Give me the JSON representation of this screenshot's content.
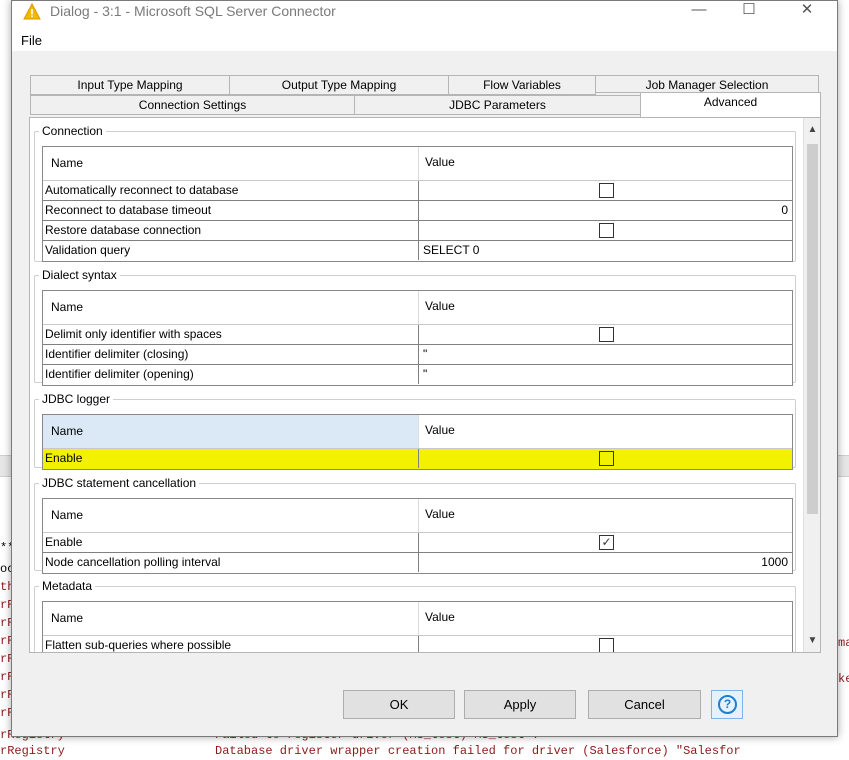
{
  "window": {
    "title": "Dialog - 3:1 - Microsoft SQL Server Connector",
    "controls": {
      "minimize": "—",
      "maximize": "☐",
      "close": "✕"
    }
  },
  "menu": {
    "file": "File"
  },
  "tabs": {
    "row1": [
      "Input Type Mapping",
      "Output Type Mapping",
      "Flow Variables",
      "Job Manager Selection"
    ],
    "row2": [
      "Connection Settings",
      "JDBC Parameters",
      "Advanced"
    ],
    "active": "Advanced"
  },
  "table_headers": {
    "name": "Name",
    "value": "Value"
  },
  "sections": {
    "connection": {
      "title": "Connection",
      "rows": [
        {
          "name": "Automatically reconnect to database",
          "value": "",
          "checked": false
        },
        {
          "name": "Reconnect to database timeout",
          "value": "0"
        },
        {
          "name": "Restore database connection",
          "value": "",
          "checked": false
        },
        {
          "name": "Validation query",
          "value": "SELECT 0"
        }
      ]
    },
    "dialect": {
      "title": "Dialect syntax",
      "rows": [
        {
          "name": "Delimit only identifier with spaces",
          "value": "",
          "checked": false
        },
        {
          "name": "Identifier delimiter (closing)",
          "value": "\""
        },
        {
          "name": "Identifier delimiter (opening)",
          "value": "\""
        }
      ]
    },
    "jdbc_logger": {
      "title": "JDBC logger",
      "rows": [
        {
          "name": "Enable",
          "value": "",
          "checked": false
        }
      ]
    },
    "cancellation": {
      "title": "JDBC statement cancellation",
      "rows": [
        {
          "name": "Enable",
          "value": "",
          "checked": true
        },
        {
          "name": "Node cancellation polling interval",
          "value": "1000"
        }
      ]
    },
    "metadata": {
      "title": "Metadata",
      "rows": [
        {
          "name": "Flatten sub-queries where possible",
          "value": "",
          "checked": false
        }
      ]
    }
  },
  "buttons": {
    "ok": "OK",
    "apply": "Apply",
    "cancel": "Cancel",
    "help": "?"
  },
  "background_console": {
    "line1": "**",
    "line2": "oc",
    "line3": "th",
    "line4": "rR",
    "line5": "rR",
    "line6": "rR",
    "line7": "rR",
    "line8": "rR",
    "line9": "rR",
    "line10": "rR",
    "line11": "rRegistry",
    "line11_msg": "Failed to register driver (MS_test) MS_test .",
    "line12": "rRegistry",
    "line12_msg": "Database driver wrapper creation failed for driver (Salesforce) \"Salesfor",
    "right1": "ma",
    "right2": "ke"
  },
  "colors": {
    "highlight": "#f2f200",
    "console_error": "#8b1a1a",
    "help_blue": "#1d7ed3"
  }
}
